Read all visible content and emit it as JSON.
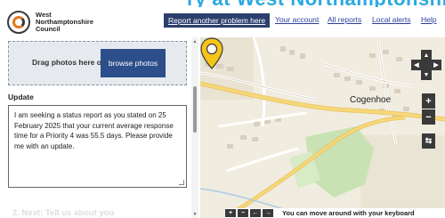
{
  "banner": {
    "cut_title": "ry at West Northamptonshire Council being"
  },
  "header": {
    "logo_lines": [
      "West",
      "Northamptonshire",
      "Council"
    ],
    "nav": {
      "report_problem": "Report another problem here",
      "your_account": "Your account",
      "all_reports": "All reports",
      "local_alerts": "Local alerts",
      "help": "Help"
    }
  },
  "form": {
    "photo_drop_text": "Drag photos here or",
    "browse_button": "browse photos",
    "update_label": "Update",
    "update_text": "I am seeking a status report as you stated on 25 February 2025 that your current average response time for a Priority 4 was 55.5 days.  Please provide me with an update.",
    "next_heading": "2. Next: Tell us about you"
  },
  "map": {
    "place_label": "Cogenhoe",
    "controls": {
      "pan_up": "▲",
      "pan_down": "▼",
      "pan_left": "◀",
      "pan_right": "▶",
      "zoom_in": "+",
      "zoom_out": "−",
      "layers": "⇆"
    },
    "keyboard_bar": {
      "buttons": [
        "+",
        "−",
        "←",
        "→"
      ],
      "text": "You can move around with your keyboard"
    },
    "colors": {
      "pin": "#f5c518",
      "road": "#f6d77a",
      "park": "#c8e2b4",
      "land": "#f1ece0"
    }
  }
}
